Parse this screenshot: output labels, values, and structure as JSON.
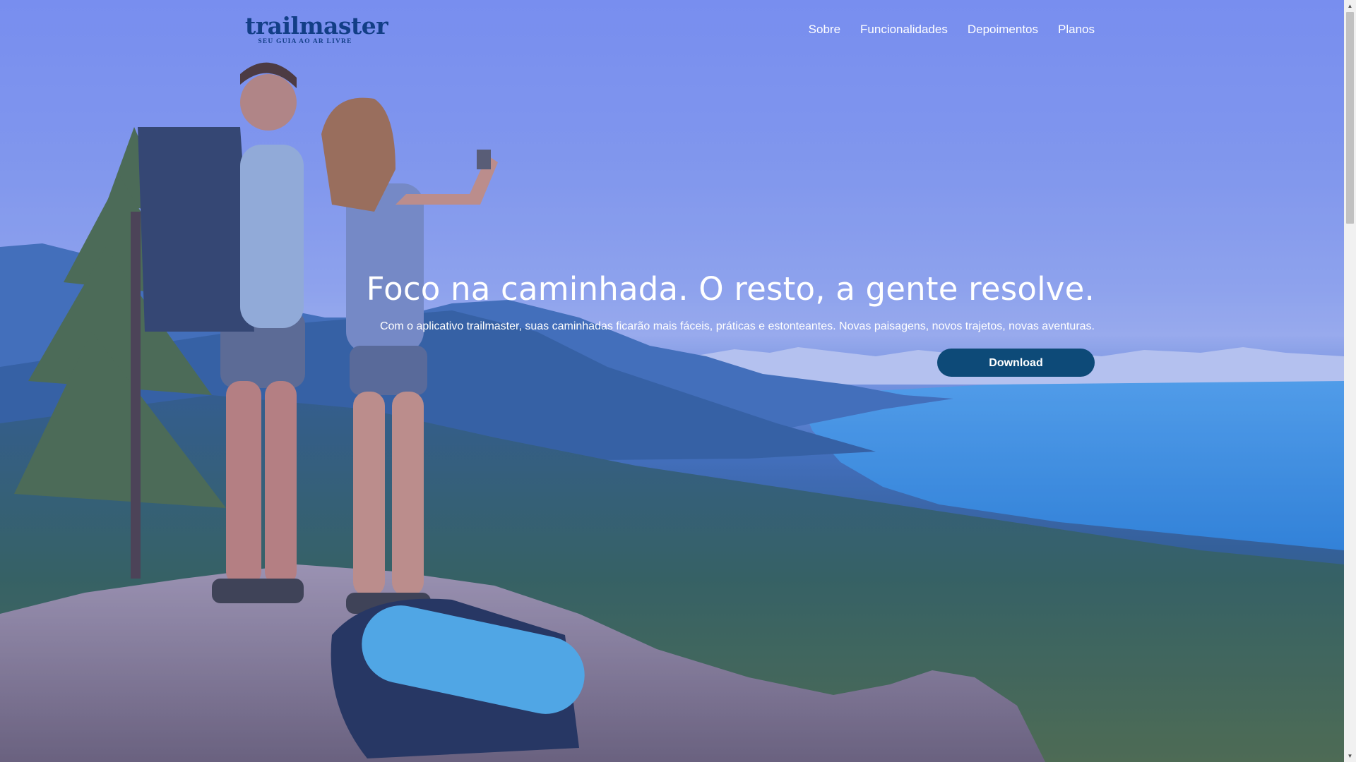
{
  "brand": {
    "name": "trailmaster",
    "tagline": "SEU GUIA AO AR LIVRE",
    "color": "#123e86"
  },
  "nav": {
    "items": [
      {
        "label": "Sobre"
      },
      {
        "label": "Funcionalidades"
      },
      {
        "label": "Depoimentos"
      },
      {
        "label": "Planos"
      }
    ]
  },
  "hero": {
    "headline": "Foco na caminhada. O resto, a gente resolve.",
    "subline": "Com o aplicativo trailmaster, suas caminhadas ficarão mais fáceis, práticas e estonteantes. Novas paisagens, novos trajetos, novas aventuras.",
    "cta_label": "Download",
    "cta_color": "#0d4a78"
  },
  "icons": {
    "scroll_up": "up-arrow",
    "scroll_down": "down-arrow"
  }
}
